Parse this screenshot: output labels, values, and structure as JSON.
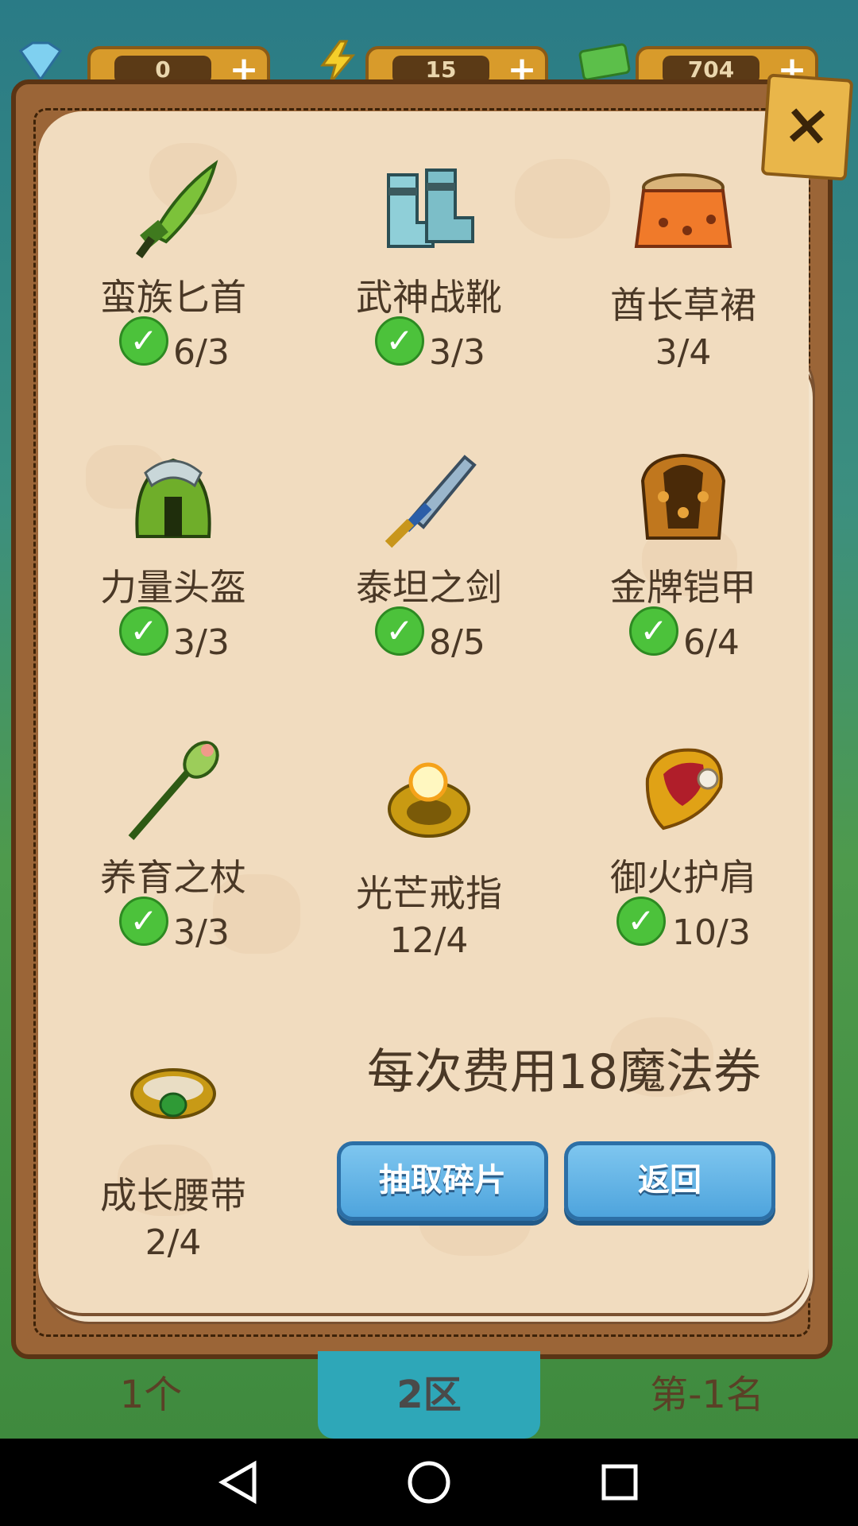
{
  "resources": [
    {
      "name": "diamond",
      "value": "0",
      "plus": "+"
    },
    {
      "name": "energy",
      "value": "15",
      "plus": "+"
    },
    {
      "name": "cash",
      "value": "704",
      "plus": "+"
    }
  ],
  "close_label": "×",
  "items": [
    {
      "name": "蛮族匕首",
      "count": "6/3",
      "complete": true
    },
    {
      "name": "武神战靴",
      "count": "3/3",
      "complete": true
    },
    {
      "name": "酋长草裙",
      "count": "3/4",
      "complete": false
    },
    {
      "name": "力量头盔",
      "count": "3/3",
      "complete": true
    },
    {
      "name": "泰坦之剑",
      "count": "8/5",
      "complete": true
    },
    {
      "name": "金牌铠甲",
      "count": "6/4",
      "complete": true
    },
    {
      "name": "养育之杖",
      "count": "3/3",
      "complete": true
    },
    {
      "name": "光芒戒指",
      "count": "12/4",
      "complete": false
    },
    {
      "name": "御火护肩",
      "count": "10/3",
      "complete": true
    },
    {
      "name": "成长腰带",
      "count": "2/4",
      "complete": false
    }
  ],
  "cost_text": "每次费用18魔法券",
  "buttons": {
    "draw": "抽取碎片",
    "back": "返回"
  },
  "tabs": {
    "left": "1个",
    "middle": "2区",
    "right": "第-1名"
  },
  "colors": {
    "check": "#4cc23b",
    "button": "#4ea4dd",
    "page": "#f1dcbf",
    "frame": "#9b6537"
  }
}
